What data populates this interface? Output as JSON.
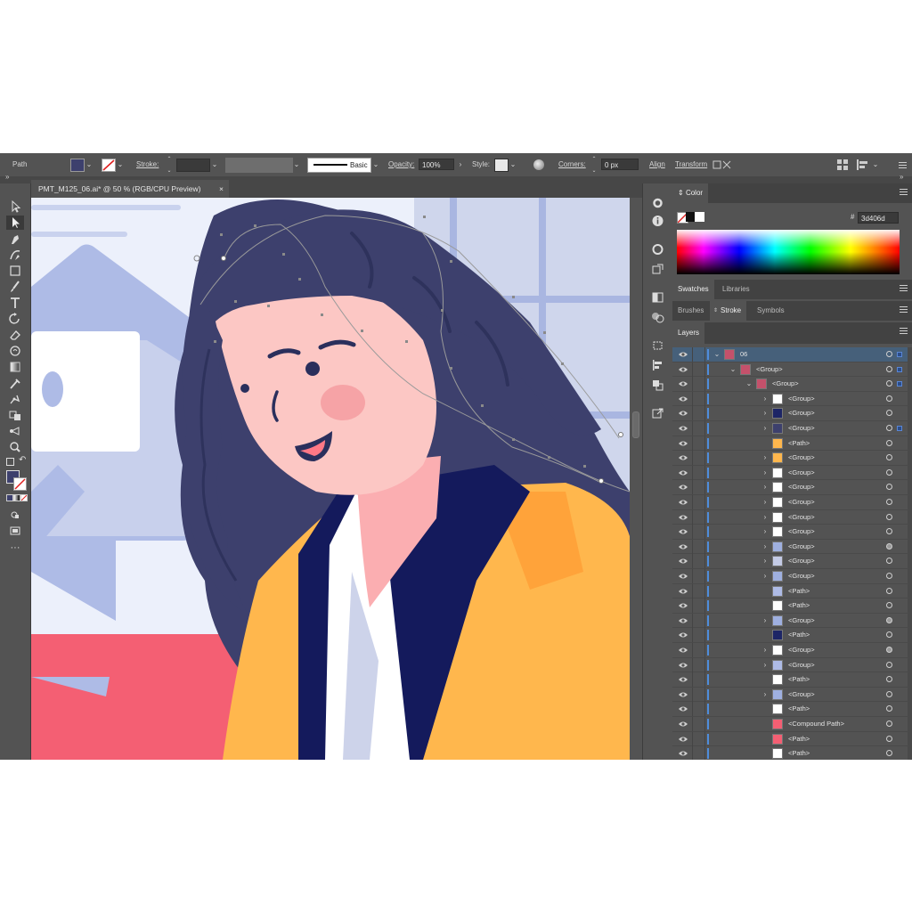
{
  "control_bar": {
    "selection_type": "Path",
    "fill_color": "#3d406d",
    "stroke_label": "Stroke:",
    "brush_style": "Basic",
    "opacity_label": "Opacity:",
    "opacity_value": "100%",
    "style_label": "Style:",
    "corners_label": "Corners:",
    "corners_value": "0 px",
    "align_label": "Align",
    "transform_label": "Transform"
  },
  "document_tab": {
    "title": "PMT_M125_06.ai* @ 50 % (RGB/CPU Preview)",
    "close": "×"
  },
  "tools": [
    "selection-tool",
    "direct-selection-tool",
    "pen-tool",
    "curvature-tool",
    "rectangle-tool",
    "paintbrush-tool",
    "type-tool",
    "rotate-tool",
    "eraser-tool",
    "warp-tool",
    "gradient-tool",
    "eyedropper-tool",
    "puppet-warp-tool",
    "artboard-tool",
    "zoom-tool",
    "swap-fill-stroke",
    "fill-stroke-swatches",
    "color-mode-buttons",
    "draw-mode",
    "screen-mode",
    "more-tools"
  ],
  "color_panel": {
    "tab_label": "Color",
    "hex_prefix": "#",
    "hex_value": "3d406d"
  },
  "swatch_tabs": [
    "Swatches",
    "Libraries"
  ],
  "stroke_tabs": [
    "Brushes",
    "Stroke",
    "Symbols"
  ],
  "layers_panel": {
    "tab_label": "Layers",
    "rows": [
      {
        "name": "06",
        "indent": 0,
        "expand": "v",
        "selected": true
      },
      {
        "name": "<Group>",
        "indent": 1,
        "expand": "v",
        "selected": false
      },
      {
        "name": "<Group>",
        "indent": 2,
        "expand": "v",
        "selected": false
      },
      {
        "name": "<Group>",
        "indent": 3,
        "expand": ">",
        "selected": false
      },
      {
        "name": "<Group>",
        "indent": 3,
        "expand": ">",
        "selected": false
      },
      {
        "name": "<Group>",
        "indent": 3,
        "expand": ">",
        "selected": false
      },
      {
        "name": "<Path>",
        "indent": 3,
        "expand": "",
        "selected": false
      },
      {
        "name": "<Group>",
        "indent": 3,
        "expand": ">",
        "selected": false
      },
      {
        "name": "<Group>",
        "indent": 3,
        "expand": ">",
        "selected": false
      },
      {
        "name": "<Group>",
        "indent": 3,
        "expand": ">",
        "selected": false
      },
      {
        "name": "<Group>",
        "indent": 3,
        "expand": ">",
        "selected": false
      },
      {
        "name": "<Group>",
        "indent": 3,
        "expand": ">",
        "selected": false
      },
      {
        "name": "<Group>",
        "indent": 3,
        "expand": ">",
        "selected": false
      },
      {
        "name": "<Group>",
        "indent": 3,
        "expand": ">",
        "selected": false
      },
      {
        "name": "<Group>",
        "indent": 3,
        "expand": ">",
        "selected": false
      },
      {
        "name": "<Group>",
        "indent": 3,
        "expand": ">",
        "selected": false
      },
      {
        "name": "<Path>",
        "indent": 3,
        "expand": "",
        "selected": false
      },
      {
        "name": "<Path>",
        "indent": 3,
        "expand": "",
        "selected": false
      },
      {
        "name": "<Group>",
        "indent": 3,
        "expand": ">",
        "selected": false
      },
      {
        "name": "<Path>",
        "indent": 3,
        "expand": "",
        "selected": false
      },
      {
        "name": "<Group>",
        "indent": 3,
        "expand": ">",
        "selected": false
      },
      {
        "name": "<Group>",
        "indent": 3,
        "expand": ">",
        "selected": false
      },
      {
        "name": "<Path>",
        "indent": 3,
        "expand": "",
        "selected": false
      },
      {
        "name": "<Group>",
        "indent": 3,
        "expand": ">",
        "selected": false
      },
      {
        "name": "<Path>",
        "indent": 3,
        "expand": "",
        "selected": false
      },
      {
        "name": "<Compound Path>",
        "indent": 3,
        "expand": "",
        "selected": false
      },
      {
        "name": "<Path>",
        "indent": 3,
        "expand": "",
        "selected": false
      },
      {
        "name": "<Path>",
        "indent": 3,
        "expand": "",
        "selected": false
      }
    ]
  }
}
